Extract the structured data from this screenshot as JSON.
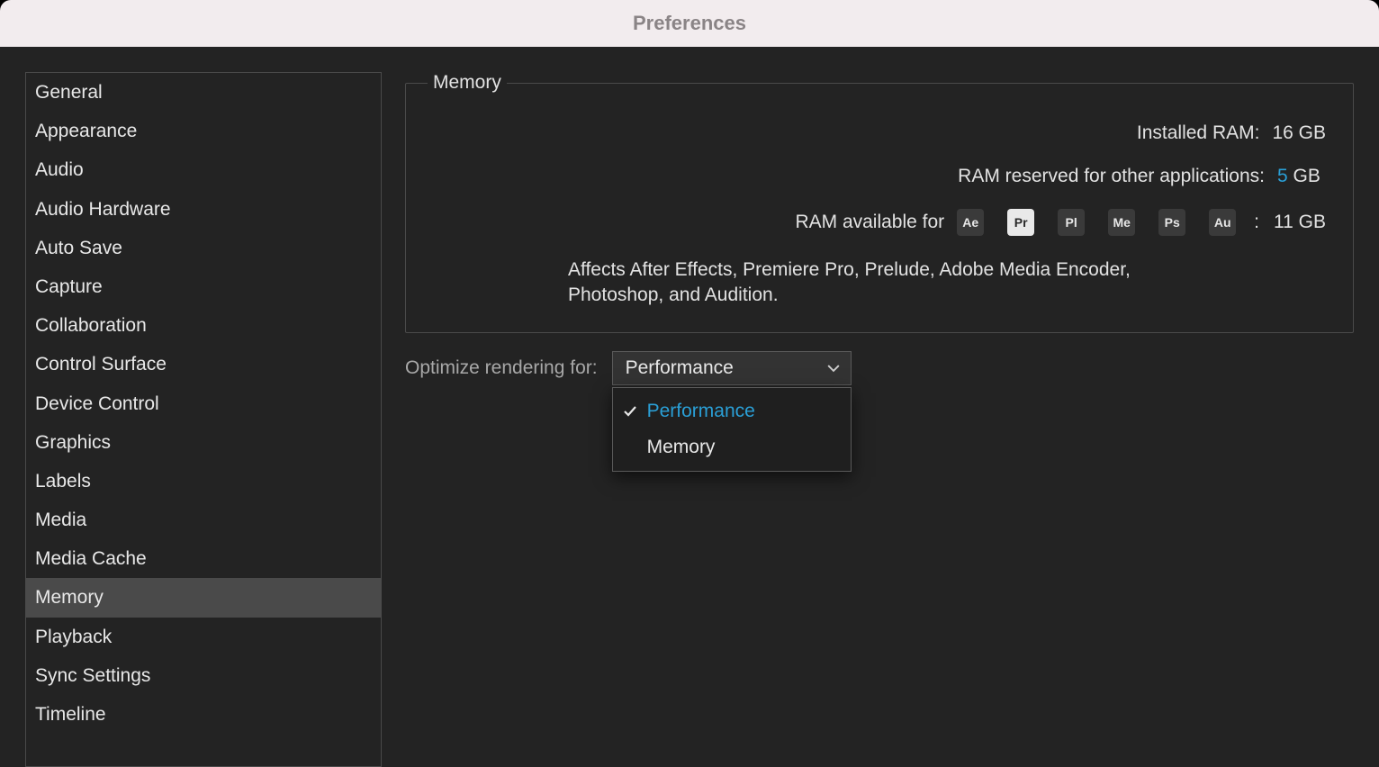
{
  "window": {
    "title": "Preferences"
  },
  "sidebar": {
    "items": [
      "General",
      "Appearance",
      "Audio",
      "Audio Hardware",
      "Auto Save",
      "Capture",
      "Collaboration",
      "Control Surface",
      "Device Control",
      "Graphics",
      "Labels",
      "Media",
      "Media Cache",
      "Memory",
      "Playback",
      "Sync Settings",
      "Timeline"
    ],
    "selected_index": 13
  },
  "memory": {
    "legend": "Memory",
    "installed_label": "Installed RAM:",
    "installed_value": "16 GB",
    "reserved_label": "RAM reserved for other applications:",
    "reserved_value_number": "5",
    "reserved_value_unit": " GB",
    "available_label": "RAM available for",
    "available_colon": ":",
    "available_value": "11 GB",
    "apps": [
      {
        "code": "Ae",
        "active": false
      },
      {
        "code": "Pr",
        "active": true
      },
      {
        "code": "Pl",
        "active": false
      },
      {
        "code": "Me",
        "active": false
      },
      {
        "code": "Ps",
        "active": false
      },
      {
        "code": "Au",
        "active": false
      }
    ],
    "affects_text": "Affects After Effects, Premiere Pro, Prelude, Adobe Media Encoder, Photoshop, and Audition."
  },
  "optimize": {
    "label": "Optimize rendering for:",
    "selected": "Performance",
    "options": [
      "Performance",
      "Memory"
    ]
  }
}
